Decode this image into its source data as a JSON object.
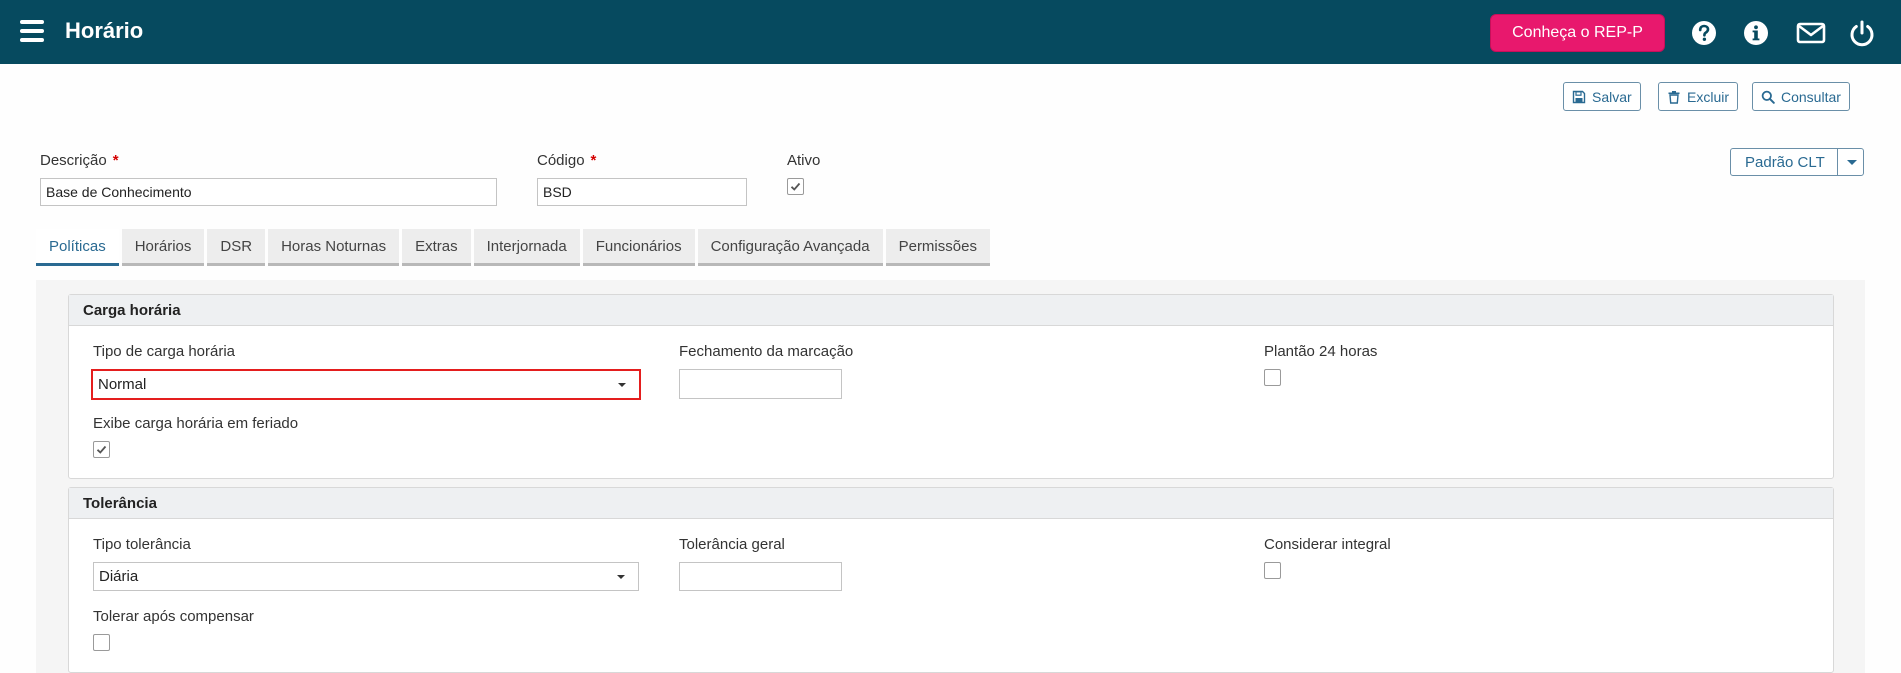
{
  "header": {
    "title": "Horário",
    "promo_label": "Conheça o REP-P",
    "background": "#064a5f",
    "promo_color": "#e8186d",
    "icons": [
      "menu-icon",
      "help-icon",
      "info-icon",
      "mail-icon",
      "power-icon"
    ]
  },
  "actions": {
    "save_label": "Salvar",
    "delete_label": "Excluir",
    "search_label": "Consultar"
  },
  "form": {
    "descricao_label": "Descrição",
    "descricao_value": "Base de Conhecimento",
    "codigo_label": "Código",
    "codigo_value": "BSD",
    "required_mark": "*",
    "ativo_label": "Ativo",
    "ativo_checked": true,
    "preset_label": "Padrão CLT"
  },
  "tabs": [
    {
      "label": "Políticas",
      "active": true
    },
    {
      "label": "Horários",
      "active": false
    },
    {
      "label": "DSR",
      "active": false
    },
    {
      "label": "Horas Noturnas",
      "active": false
    },
    {
      "label": "Extras",
      "active": false
    },
    {
      "label": "Interjornada",
      "active": false
    },
    {
      "label": "Funcionários",
      "active": false
    },
    {
      "label": "Configuração Avançada",
      "active": false
    },
    {
      "label": "Permissões",
      "active": false
    }
  ],
  "carga": {
    "title": "Carga horária",
    "tipo_label": "Tipo de carga horária",
    "tipo_value": "Normal",
    "fechamento_label": "Fechamento da marcação",
    "fechamento_value": "",
    "plantao_label": "Plantão 24 horas",
    "plantao_checked": false,
    "feriado_label": "Exibe carga horária em feriado",
    "feriado_checked": true
  },
  "tolerancia": {
    "title": "Tolerância",
    "tipo_label": "Tipo tolerância",
    "tipo_value": "Diária",
    "geral_label": "Tolerância geral",
    "geral_value": "",
    "integral_label": "Considerar integral",
    "integral_checked": false,
    "compensar_label": "Tolerar após compensar",
    "compensar_checked": false
  },
  "colors": {
    "accent": "#2a6a92",
    "highlight_border": "#e41e1e"
  }
}
